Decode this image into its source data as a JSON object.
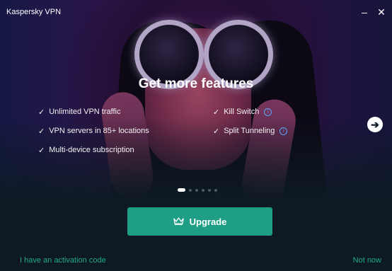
{
  "window": {
    "title": "Kaspersky VPN",
    "minimize_icon": "minimize-icon",
    "close_icon": "close-icon"
  },
  "hero": {
    "headline": "Get more features",
    "features_left": [
      "Unlimited VPN traffic",
      "VPN servers in 85+ locations",
      "Multi-device subscription"
    ],
    "features_right": [
      "Kill Switch",
      "Split Tunneling"
    ],
    "check_glyph": "✓",
    "info_glyph": "i",
    "next_glyph": "➔",
    "carousel": {
      "total": 6,
      "active": 1
    }
  },
  "actions": {
    "upgrade_label": "Upgrade",
    "activation_link": "I have an activation code",
    "not_now_link": "Not now"
  },
  "colors": {
    "accent": "#1f9e86",
    "link": "#1fa98e",
    "info": "#5aa8ff"
  }
}
